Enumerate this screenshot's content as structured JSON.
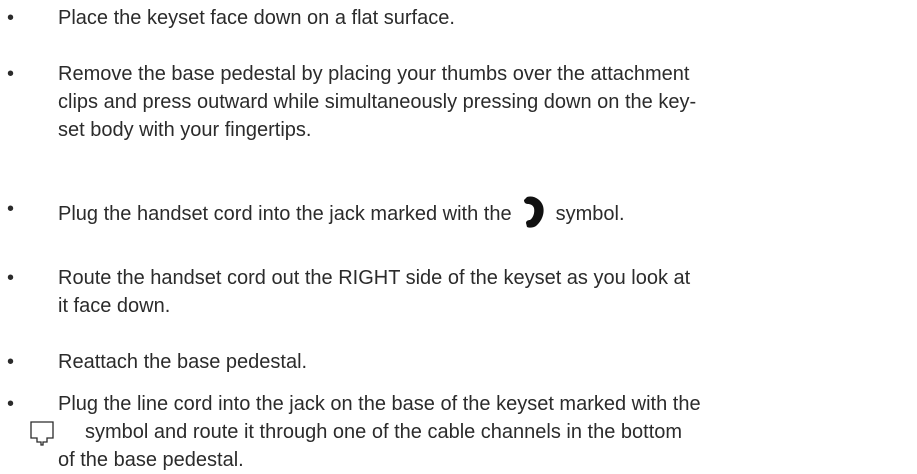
{
  "instructions": {
    "item1": "Place the keyset face down on a flat surface.",
    "item2": {
      "line1": "Remove the base pedestal by placing your thumbs over the attachment",
      "line2": "clips and press outward while simultaneously pressing down on the key-",
      "line3": "set body with your fingertips."
    },
    "item3": {
      "before": "Plug the handset cord into the jack marked with the",
      "after": "symbol.",
      "icon": "handset-icon"
    },
    "item4": {
      "line1": "Route the handset cord out the RIGHT side of the keyset as you look at",
      "line2": "it face down."
    },
    "item5": "Reattach the base pedestal.",
    "item6": {
      "line1": "Plug the line cord into the jack on the base of the keyset marked with the",
      "line2": "symbol and route it through one of the cable channels in the bottom",
      "line3": "of the base pedestal.",
      "icon": "phone-jack-icon"
    },
    "bullet_char": "•"
  }
}
